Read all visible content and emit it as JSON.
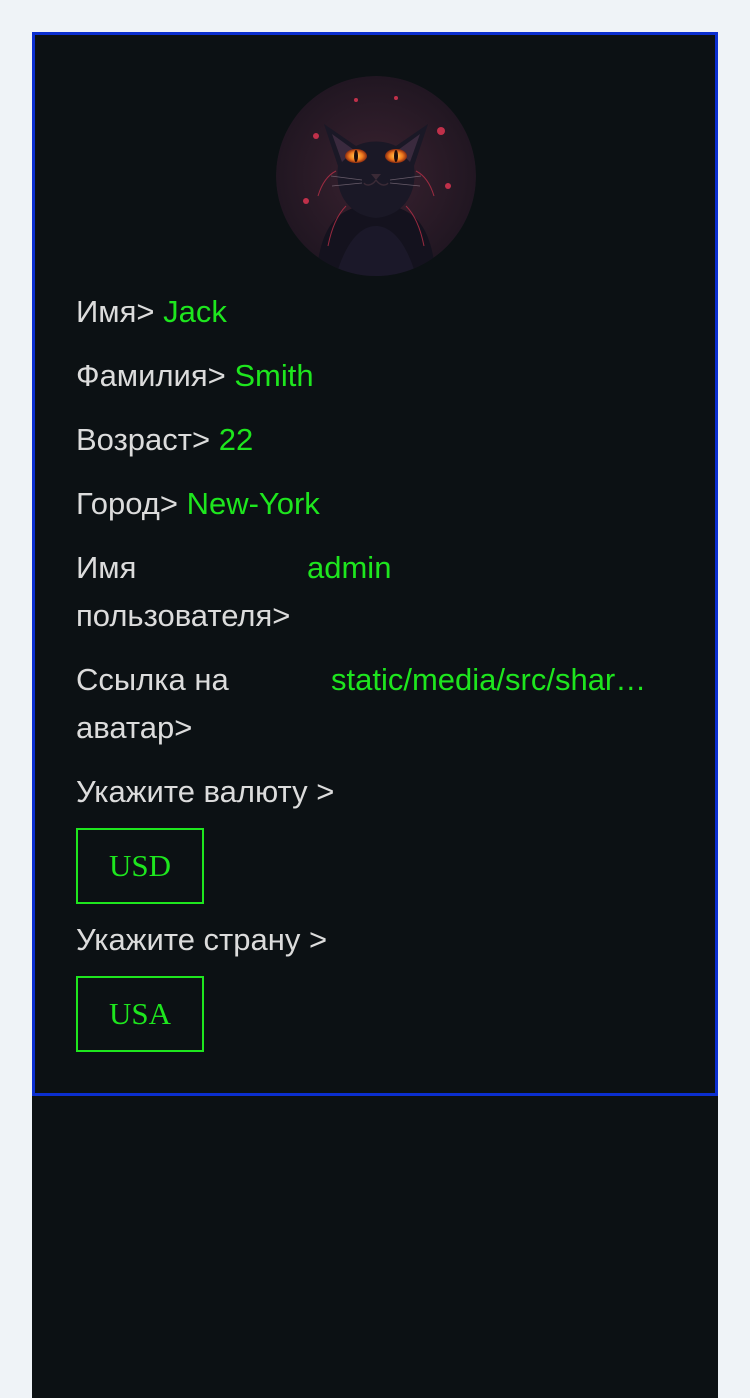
{
  "profile": {
    "first_name_label": "Имя>",
    "first_name": "Jack",
    "last_name_label": "Фамилия>",
    "last_name": "Smith",
    "age_label": "Возраст>",
    "age": "22",
    "city_label": "Город>",
    "city": "New-York",
    "username_label_line1": "Имя",
    "username_label_line2": "пользователя>",
    "username": "admin",
    "avatar_link_label_line1": "Ссылка на",
    "avatar_link_label_line2": "аватар>",
    "avatar_link": "static/media/src/shar…",
    "currency_label": "Укажите валюту >",
    "currency": "USD",
    "country_label": "Укажите страну >",
    "country": "USA"
  },
  "avatar_icon": "black-cat-avatar",
  "colors": {
    "value_green": "#1ee61e",
    "border_blue": "#0b2fd0",
    "card_bg": "#0c1114",
    "page_bg": "#eff3f7"
  }
}
